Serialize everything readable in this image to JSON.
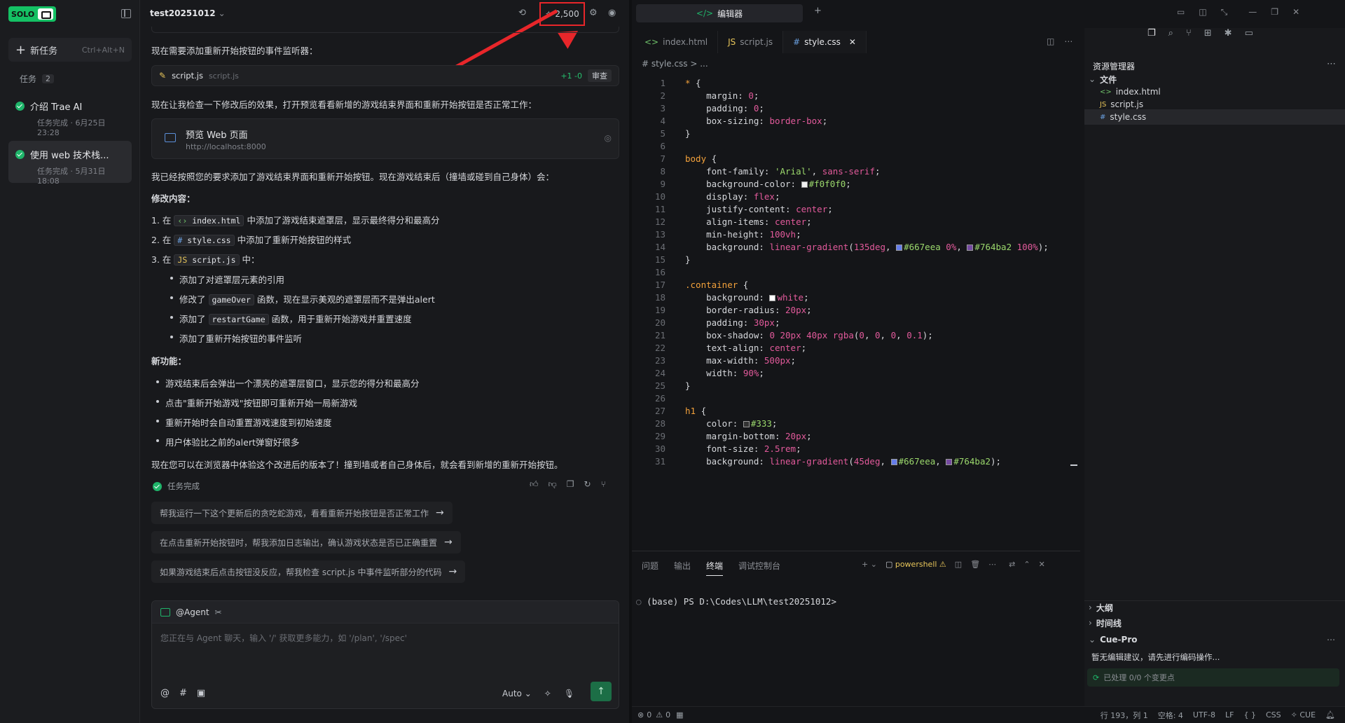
{
  "sidebar": {
    "logo_text": "SOLO",
    "new_task_label": "新任务",
    "new_task_shortcut": "Ctrl+Alt+N",
    "tasks_label": "任务",
    "tasks_count": "2",
    "tasks": [
      {
        "title": "介绍 Trae AI",
        "status": "任务完成 · 6月25日 23:28"
      },
      {
        "title": "使用 web 技术栈...",
        "status": "任务完成 · 5月31日 18:08"
      }
    ]
  },
  "chat": {
    "project_title": "test20251012",
    "credits": "2,500",
    "para1": "现在需要添加重新开始按钮的事件监听器：",
    "file_card": {
      "name": "script.js",
      "path": "script.js",
      "diff": "+1 -0",
      "review": "审查"
    },
    "para2": "现在让我检查一下修改后的效果，打开预览看看新增的游戏结束界面和重新开始按钮是否正常工作：",
    "preview": {
      "title": "预览 Web 页面",
      "url": "http://localhost:8000"
    },
    "para3": "我已经按照您的要求添加了游戏结束界面和重新开始按钮。现在游戏结束后（撞墙或碰到自己身体）会：",
    "changes_heading": "修改内容：",
    "changes": [
      {
        "num": "1.",
        "pre": "在",
        "file": "index.html",
        "post": "中添加了游戏结束遮罩层，显示最终得分和最高分"
      },
      {
        "num": "2.",
        "pre": "在",
        "file": "style.css",
        "post": "中添加了重新开始按钮的样式"
      },
      {
        "num": "3.",
        "pre": "在",
        "file": "script.js",
        "post": "中："
      }
    ],
    "sub_items": [
      {
        "pre": "添加了对遮罩层元素的引用",
        "code": "",
        "post": ""
      },
      {
        "pre": "修改了",
        "code": "gameOver",
        "post": "函数，现在显示美观的遮罩层而不是弹出alert"
      },
      {
        "pre": "添加了",
        "code": "restartGame",
        "post": "函数，用于重新开始游戏并重置速度"
      },
      {
        "pre": "添加了重新开始按钮的事件监听",
        "code": "",
        "post": ""
      }
    ],
    "features_heading": "新功能：",
    "features": [
      "游戏结束后会弹出一个漂亮的遮罩层窗口，显示您的得分和最高分",
      "点击\"重新开始游戏\"按钮即可重新开始一局新游戏",
      "重新开始时会自动重置游戏速度到初始速度",
      "用户体验比之前的alert弹窗好很多"
    ],
    "para4": "现在您可以在浏览器中体验这个改进后的版本了！撞到墙或者自己身体后，就会看到新增的重新开始按钮。",
    "done_label": "任务完成",
    "suggestions": [
      "帮我运行一下这个更新后的贪吃蛇游戏，看看重新开始按钮是否正常工作",
      "在点击重新开始按钮时，帮我添加日志输出，确认游戏状态是否已正确重置",
      "如果游戏结束后点击按钮没反应，帮我检查 script.js 中事件监听部分的代码"
    ],
    "agent_label": "@Agent",
    "input_placeholder": "您正在与 Agent 聊天，输入 '/' 获取更多能力，如 '/plan', '/spec'",
    "model_label": "Auto"
  },
  "editor": {
    "top_tab_label": "编辑器",
    "file_tabs": [
      {
        "icon": "<>",
        "name": "index.html"
      },
      {
        "icon": "JS",
        "name": "script.js"
      },
      {
        "icon": "#",
        "name": "style.css"
      }
    ],
    "breadcrumb": "# style.css > ...",
    "code_lines": [
      "* {",
      "    margin: 0;",
      "    padding: 0;",
      "    box-sizing: border-box;",
      "}",
      "",
      "body {",
      "    font-family: 'Arial', sans-serif;",
      "    background-color: #f0f0f0;",
      "    display: flex;",
      "    justify-content: center;",
      "    align-items: center;",
      "    min-height: 100vh;",
      "    background: linear-gradient(135deg, #667eea 0%, #764ba2 100%);",
      "}",
      "",
      ".container {",
      "    background: white;",
      "    border-radius: 20px;",
      "    padding: 30px;",
      "    box-shadow: 0 20px 40px rgba(0, 0, 0, 0.1);",
      "    text-align: center;",
      "    max-width: 500px;",
      "    width: 90%;",
      "}",
      "",
      "h1 {",
      "    color: #333;",
      "    margin-bottom: 20px;",
      "    font-size: 2.5rem;",
      "    background: linear-gradient(45deg, #667eea, #764ba2);"
    ],
    "panel_tabs": [
      "问题",
      "输出",
      "终端",
      "调试控制台"
    ],
    "terminal_name": "powershell",
    "terminal_line": "(base) PS D:\\Codes\\LLM\\test20251012>",
    "explorer": {
      "title": "资源管理器",
      "folder": "文件",
      "files": [
        {
          "icon": "<>",
          "name": "index.html"
        },
        {
          "icon": "JS",
          "name": "script.js"
        },
        {
          "icon": "#",
          "name": "style.css"
        }
      ],
      "outline": "大纲",
      "timeline": "时间线",
      "cue_title": "Cue-Pro",
      "cue_msg": "暂无编辑建议，请先进行编码操作...",
      "cue_status": "已处理 0/0 个变更点"
    },
    "status": {
      "errors": "0",
      "warnings": "0",
      "position": "行 193，列 1",
      "spaces": "空格: 4",
      "encoding": "UTF-8",
      "eol": "LF",
      "braces": "{ }",
      "lang": "CSS",
      "cue": "CUE"
    }
  },
  "colors": {
    "accent_green": "#1fb56a",
    "highlight_red": "#e8262a",
    "swatch_f0f0f0": "#f0f0f0",
    "swatch_667eea": "#667eea",
    "swatch_764ba2": "#764ba2",
    "swatch_white": "#ffffff",
    "swatch_333": "#333333"
  }
}
